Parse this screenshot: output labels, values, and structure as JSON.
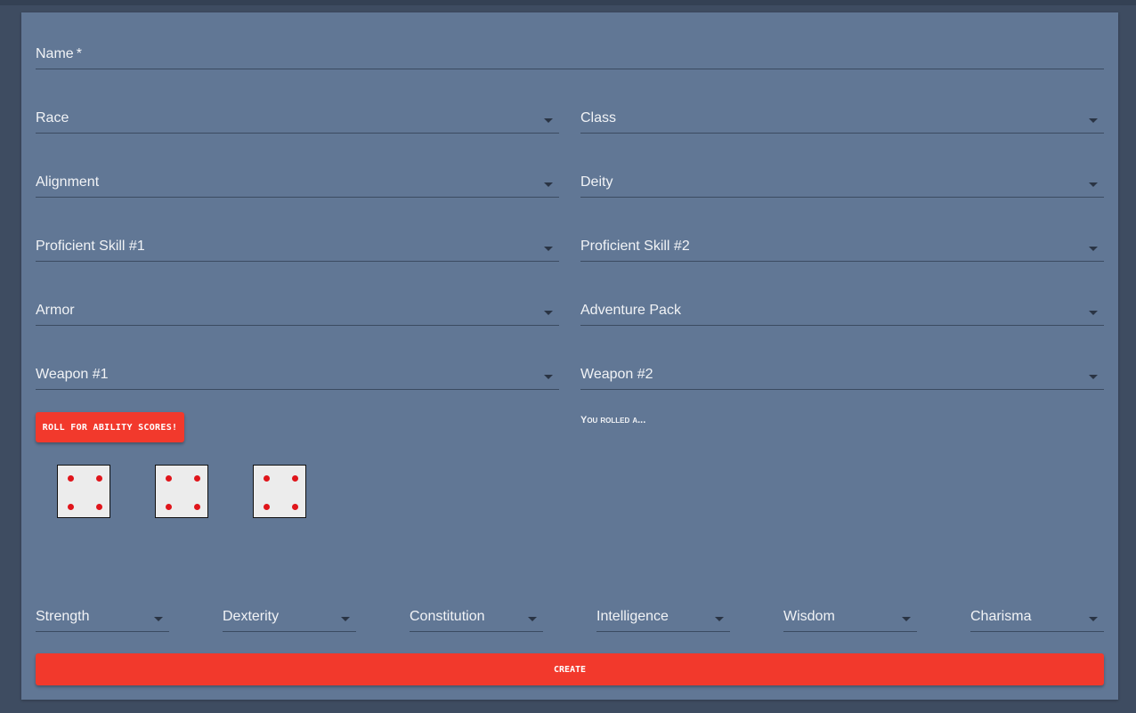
{
  "form": {
    "name_label": "Name",
    "name_required_marker": "*",
    "name_value": ""
  },
  "selects": {
    "race": "Race",
    "class": "Class",
    "alignment": "Alignment",
    "deity": "Deity",
    "skill1": "Proficient Skill #1",
    "skill2": "Proficient Skill #2",
    "armor": "Armor",
    "pack": "Adventure Pack",
    "weapon1": "Weapon #1",
    "weapon2": "Weapon #2"
  },
  "roll": {
    "button_label": "Roll for ability scores!",
    "result_text": "You rolled a...",
    "dice": [
      4,
      4,
      4
    ],
    "pip_color": "#e0151b"
  },
  "abilities": {
    "strength": "Strength",
    "dexterity": "Dexterity",
    "constitution": "Constitution",
    "intelligence": "Intelligence",
    "wisdom": "Wisdom",
    "charisma": "Charisma"
  },
  "actions": {
    "create_label": "Create"
  },
  "colors": {
    "background": "#3e4c61",
    "card": "#617795",
    "accent": "#f2392c"
  },
  "icons": {
    "dropdown": "caret-down-icon",
    "die": "die-face-icon"
  }
}
